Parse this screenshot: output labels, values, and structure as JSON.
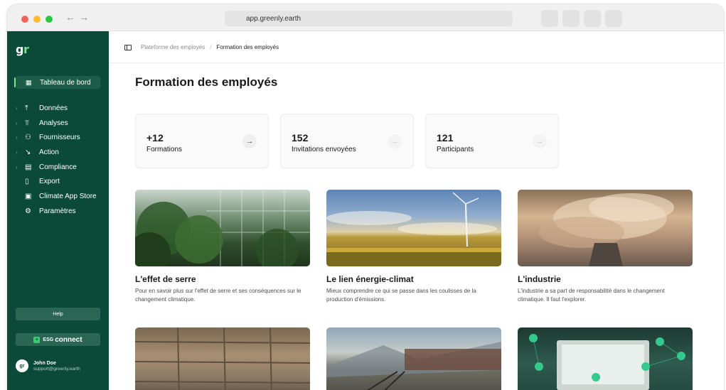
{
  "browser": {
    "url": "app.greenly.earth",
    "back_icon": "←",
    "forward_icon": "→"
  },
  "sidebar": {
    "logo_main": "g",
    "logo_accent": "r",
    "active_item": {
      "label": "Tableau de bord",
      "icon": "grid-icon"
    },
    "items": [
      {
        "label": "Données",
        "icon": "upload-icon",
        "chevron": true
      },
      {
        "label": "Analyses",
        "icon": "chart-icon",
        "chevron": true
      },
      {
        "label": "Fournisseurs",
        "icon": "suppliers-icon",
        "chevron": true
      },
      {
        "label": "Action",
        "icon": "trend-down-icon",
        "chevron": true
      },
      {
        "label": "Compliance",
        "icon": "document-icon",
        "chevron": true
      },
      {
        "label": "Export",
        "icon": "file-icon",
        "chevron": false
      },
      {
        "label": "Climate App Store",
        "icon": "store-icon",
        "chevron": false
      },
      {
        "label": "Paramètres",
        "icon": "gear-icon",
        "chevron": false
      }
    ],
    "help_label": "Help",
    "esg_prefix": "ESG",
    "esg_label": "connect",
    "user": {
      "avatar_text": "gr",
      "name": "John Doe",
      "email": "support@greenly.earth"
    }
  },
  "breadcrumb": {
    "parent": "Plateforme des employés",
    "separator": "/",
    "current": "Formation des employés"
  },
  "page_title": "Formation des employés",
  "stats": [
    {
      "value": "+12",
      "label": "Formations",
      "arrow": "→"
    },
    {
      "value": "152",
      "label": "Invitations envoyées",
      "arrow": "→"
    },
    {
      "value": "121",
      "label": "Participants",
      "arrow": "→"
    }
  ],
  "cards": [
    {
      "title": "L'effet de serre",
      "description": "Pour en savoir plus sur l'effet de serre et ses conséquences sur le changement climatique."
    },
    {
      "title": "Le lien énergie-climat",
      "description": "Mieux comprendre ce qui se passe dans les coulisses de la production d'émissions."
    },
    {
      "title": "L'industrie",
      "description": "L'industrie a sa part de responsabilité dans le changement climatique. Il faut l'explorer."
    }
  ],
  "colors": {
    "sidebar_bg": "#0b4a38",
    "accent_green": "#7fe08a"
  }
}
